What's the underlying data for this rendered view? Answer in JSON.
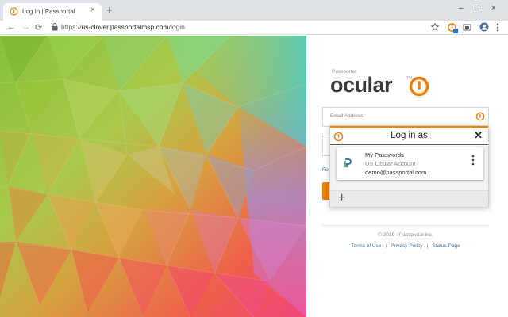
{
  "browser": {
    "tab_title": "Log In | Passportal",
    "tab_close": "×",
    "new_tab": "+",
    "window_controls": [
      "–",
      "□",
      "×"
    ],
    "url_prefix": "https://",
    "url_domain": "us-clover.passportalmsp.com",
    "url_path": "/login",
    "nav": {
      "back": "←",
      "forward": "→",
      "reload": "⟳"
    },
    "toolbar_icons": [
      "star-icon",
      "ocular-extension-icon",
      "screenshot-icon",
      "profile-avatar-icon",
      "menu-icon"
    ]
  },
  "login": {
    "brand_small": "Passportal",
    "brand_word": "ocular",
    "brand_tm": "TM",
    "email_label": "Email Address",
    "forgot_label": "For",
    "copyright": "© 2019 - Passportal Inc.",
    "footer_links": [
      "Terms of Use",
      "Privacy Policy",
      "Status Page"
    ],
    "footer_separator": "|"
  },
  "popup": {
    "title": "Log in as",
    "close": "✕",
    "account": {
      "name": "My Passwords",
      "type": "US Ocular Account",
      "email": "demo@passportal.com"
    },
    "add_label": "+"
  },
  "colors": {
    "accent": "#f07d00",
    "popup_top": "#d9891e",
    "link": "#3a6f9a"
  }
}
